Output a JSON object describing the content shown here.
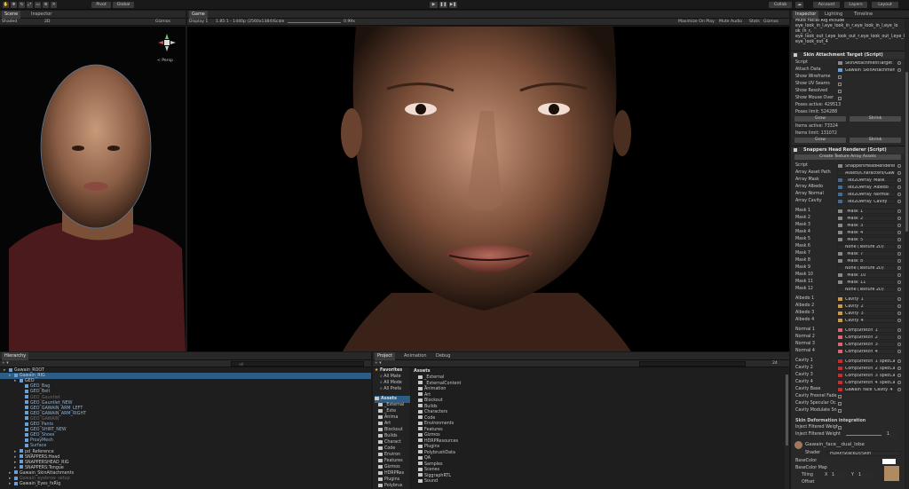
{
  "toolbar": {
    "pivot": "Pivot",
    "global": "Global",
    "collab": "Collab",
    "account": "Account",
    "layers": "Layers",
    "layout": "Layout"
  },
  "scene": {
    "tab_scene": "Scene",
    "tab_inspector": "Inspector",
    "shaded": "Shaded",
    "mode2d": "2D",
    "gizmos": "Gizmos",
    "persp": "< Persp"
  },
  "game": {
    "tab": "Game",
    "display": "Display 1",
    "res": "1.85:1 - 1440p (2560x1384)",
    "scale_label": "Scale",
    "scale_value": "0.99x",
    "maximize": "Maximize On Play",
    "mute": "Mute Audio",
    "stats": "Stats",
    "gizmos": "Gizmos"
  },
  "inspector": {
    "tabs": [
      "Inspector",
      "Lighting",
      "Timeline"
    ],
    "top_lines": [
      "Mute Facial Rig Include",
      "eye_look_in_l,eye_look_in_r,eye_look_in_l,eye_lo",
      "ok_in_r,",
      "eye_look_out_l,eye_look_out_r,eye_look_out_l,eye_look_out_r",
      "eye_look_out_4"
    ],
    "skin_attach": {
      "title": "Skin Attachment Target (Script)",
      "script_label": "Script",
      "script_value": "SkinAttachmentTarget",
      "attach_label": "Attach Data",
      "attach_value": "Gawain_SkinAttachment",
      "rows": [
        "Show Wireframe",
        "Show UV Seams",
        "Show Resolved",
        "Show Mouse Over"
      ],
      "poses_active": "Poses active: 429513",
      "poses_limit": "Poses limit: 524288",
      "grow": "Grow",
      "shrink": "Shrink",
      "items_active": "Items active: 73324",
      "items_limit": "Items limit: 131072",
      "grow2": "Grow",
      "shrink2": "Shrink"
    },
    "head_renderer": {
      "title": "Snappers Head Renderer (Script)",
      "create_btn": "Create Texture Array Assets",
      "script_label": "Script",
      "script_value": "SnappersHeadRenderer",
      "fields": [
        {
          "label": "Array Asset Path",
          "value": "Assets/Characters/Gawain/Ti",
          "color": ""
        },
        {
          "label": "Array Mask",
          "value": "_Tex2DArray_Mask",
          "color": "#4a6a8a"
        },
        {
          "label": "Array Albedo",
          "value": "_Tex2DArray_Albedo",
          "color": "#4a6a8a"
        },
        {
          "label": "Array Normal",
          "value": "_Tex2DArray_Normal",
          "color": "#4a6a8a"
        },
        {
          "label": "Array Cavity",
          "value": "_Tex2DArray_Cavity",
          "color": "#4a6a8a"
        },
        {
          "label": "Mask 1",
          "value": "_Mask_1",
          "color": "#888"
        },
        {
          "label": "Mask 2",
          "value": "_Mask_2",
          "color": "#888"
        },
        {
          "label": "Mask 3",
          "value": "_Mask_3",
          "color": "#888"
        },
        {
          "label": "Mask 4",
          "value": "_Mask_4",
          "color": "#888"
        },
        {
          "label": "Mask 5",
          "value": "_Mask_5",
          "color": "#888"
        },
        {
          "label": "Mask 6",
          "value": "None (Texture 2D)",
          "color": ""
        },
        {
          "label": "Mask 7",
          "value": "_Mask_7",
          "color": "#888"
        },
        {
          "label": "Mask 8",
          "value": "_Mask_8",
          "color": "#888"
        },
        {
          "label": "Mask 9",
          "value": "None (Texture 2D)",
          "color": ""
        },
        {
          "label": "Mask 10",
          "value": "_Mask_10",
          "color": "#888"
        },
        {
          "label": "Mask 11",
          "value": "_Mask_11",
          "color": "#888"
        },
        {
          "label": "Mask 12",
          "value": "None (Texture 2D)",
          "color": ""
        },
        {
          "label": "Albedo 1",
          "value": "Cavity_1",
          "color": "#c89a50"
        },
        {
          "label": "Albedo 2",
          "value": "Cavity_2",
          "color": "#c89a50"
        },
        {
          "label": "Albedo 3",
          "value": "Cavity_3",
          "color": "#c89a50"
        },
        {
          "label": "Albedo 4",
          "value": "Cavity_4",
          "color": "#c89a50"
        },
        {
          "label": "Normal 1",
          "value": "CompStretch_1",
          "color": "#d06a7a"
        },
        {
          "label": "Normal 2",
          "value": "CompStretch_2",
          "color": "#d06a7a"
        },
        {
          "label": "Normal 3",
          "value": "CompStretch_3",
          "color": "#d06a7a"
        },
        {
          "label": "Normal 4",
          "value": "CompStretch_4",
          "color": "#d06a7a"
        },
        {
          "label": "Cavity 1",
          "value": "CompStretch_1_specCa",
          "color": "#c03030"
        },
        {
          "label": "Cavity 2",
          "value": "CompStretch_2_specCa",
          "color": "#c03030"
        },
        {
          "label": "Cavity 3",
          "value": "CompStretch_3_specCa",
          "color": "#c03030"
        },
        {
          "label": "Cavity 4",
          "value": "CompStretch_4_specCa",
          "color": "#c03030"
        },
        {
          "label": "Cavity Base",
          "value": "Gawain_face_Cavity_4",
          "color": "#c03030"
        }
      ],
      "checks": [
        "Cavity Fresnel Fade",
        "Cavity Specular Oc",
        "Cavity Modulate Sn"
      ]
    },
    "deform": {
      "title": "Skin Deformation integration",
      "inject_filtered": "Inject Filtered Weight",
      "inject_weight": "Inject Filtered Weight",
      "weight_value": "1"
    },
    "material": {
      "name": "Gawain_face__dual_lobe",
      "shader_label": "Shader",
      "shader_value": "HDRP/StackLit/Skin",
      "basecolor": "BaseColor",
      "basecolor_map": "BaseColor Map",
      "tiling": "Tiling",
      "offset": "Offset",
      "x": "X",
      "y": "Y",
      "tx": "1",
      "ty": "1"
    }
  },
  "hierarchy": {
    "tab": "Hierarchy",
    "search_placeholder": "All",
    "rows": [
      {
        "text": "Gawain_ROOT",
        "indent": 0,
        "cube": true,
        "sel": false,
        "dim": false
      },
      {
        "text": "Gawain_RIG",
        "indent": 1,
        "cube": true,
        "sel": true,
        "dim": false
      },
      {
        "text": "GEO",
        "indent": 2,
        "cube": true,
        "sel": false,
        "dim": false
      },
      {
        "text": "GEO_Bag",
        "indent": 3,
        "cube": true,
        "sel": false,
        "dim": false
      },
      {
        "text": "GEO_Belt",
        "indent": 3,
        "cube": true,
        "sel": false,
        "dim": false
      },
      {
        "text": "GEO_Gauntlet",
        "indent": 3,
        "cube": true,
        "sel": false,
        "dim": true
      },
      {
        "text": "GEO_Gauntlet_NEW",
        "indent": 3,
        "cube": true,
        "sel": false,
        "dim": false
      },
      {
        "text": "GEO_GAWAIN_ARM_LEFT",
        "indent": 3,
        "cube": true,
        "sel": false,
        "dim": false
      },
      {
        "text": "GEO_GAWAIN_ARM_RIGHT",
        "indent": 3,
        "cube": true,
        "sel": false,
        "dim": false
      },
      {
        "text": "GEO_GAWAIN",
        "indent": 3,
        "cube": true,
        "sel": false,
        "dim": true
      },
      {
        "text": "GEO_Pants",
        "indent": 3,
        "cube": true,
        "sel": false,
        "dim": false
      },
      {
        "text": "GEO_SHIRT_NEW",
        "indent": 3,
        "cube": true,
        "sel": false,
        "dim": false
      },
      {
        "text": "GEO_Shoes",
        "indent": 3,
        "cube": true,
        "sel": false,
        "dim": false
      },
      {
        "text": "ProxyMesh",
        "indent": 3,
        "cube": true,
        "sel": false,
        "dim": false
      },
      {
        "text": "Surface",
        "indent": 3,
        "cube": true,
        "sel": false,
        "dim": false
      },
      {
        "text": "pd_Reference",
        "indent": 2,
        "cube": true,
        "sel": false,
        "dim": false
      },
      {
        "text": "SNAPPERS:Head",
        "indent": 2,
        "cube": true,
        "sel": false,
        "dim": false
      },
      {
        "text": "SNAPPERSHEAD_RIG",
        "indent": 2,
        "cube": true,
        "sel": false,
        "dim": false
      },
      {
        "text": "SNAPPERS:Tongue",
        "indent": 2,
        "cube": true,
        "sel": false,
        "dim": false
      },
      {
        "text": "Gawain_SkinAttachments",
        "indent": 1,
        "cube": true,
        "sel": false,
        "dim": false
      },
      {
        "text": "Gawain_eyebrow_setup",
        "indent": 1,
        "cube": true,
        "sel": false,
        "dim": true
      },
      {
        "text": "Gawain_Eyes_fxRig",
        "indent": 1,
        "cube": true,
        "sel": false,
        "dim": false
      }
    ]
  },
  "project": {
    "tabs": [
      "Project",
      "Animation",
      "Debug"
    ],
    "search_placeholder": "",
    "count": "24",
    "favorites_title": "Favorites",
    "favorites": [
      "All Mate",
      "All Mode",
      "All Prefa"
    ],
    "assets_title": "Assets",
    "tree": [
      "_External",
      "_Exte",
      "Anima",
      "Art",
      "Blockout",
      "Builds",
      "Charact",
      "Code",
      "Environ",
      "Features",
      "Gizmos",
      "HDRPRes",
      "Plugins",
      "Polybrus",
      "QA",
      "Samples"
    ],
    "assets_header": "Assets",
    "list": [
      "_External",
      "_ExternalContent",
      "Animation",
      "Art",
      "Blockout",
      "Builds",
      "Characters",
      "Code",
      "Environments",
      "Features",
      "Gizmos",
      "HDRPResources",
      "Plugins",
      "PolybrushData",
      "QA",
      "Samples",
      "Scenes",
      "SiggraphRTL",
      "Sound"
    ]
  }
}
